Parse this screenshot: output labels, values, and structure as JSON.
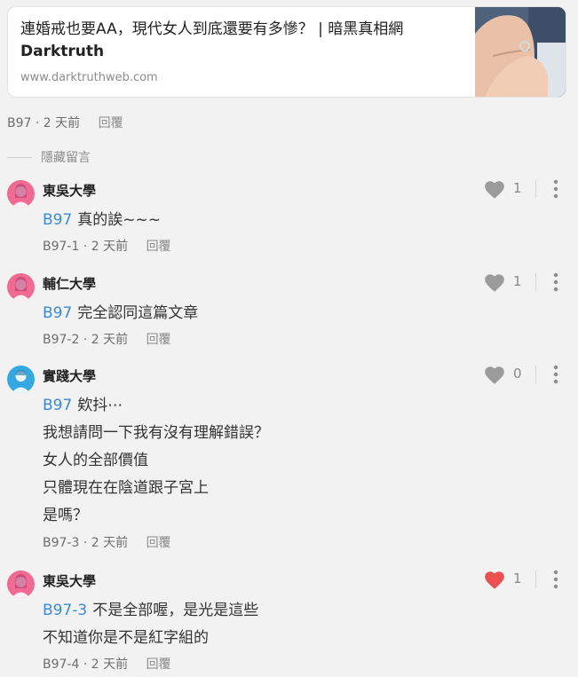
{
  "link_card": {
    "title": "連婚戒也要AA，現代女人到底還要有多慘？ | 暗黑真相網",
    "brand": "Darktruth",
    "url": "www.darktruthweb.com"
  },
  "parent_meta": {
    "floor": "B97",
    "time": "2 天前",
    "reply": "回覆"
  },
  "hidden_label": "隱藏留言",
  "comments": [
    {
      "school": "東吳大學",
      "avatar_color": "#f06a93",
      "tag": "B97",
      "lines": [
        "真的誒~~~"
      ],
      "floor": "B97-1",
      "time": "2 天前",
      "reply": "回覆",
      "likes": "1",
      "liked": false,
      "like_icon": "heart-icon"
    },
    {
      "school": "輔仁大學",
      "avatar_color": "#f06a93",
      "tag": "B97",
      "lines": [
        "完全認同這篇文章"
      ],
      "floor": "B97-2",
      "time": "2 天前",
      "reply": "回覆",
      "likes": "1",
      "liked": false,
      "like_icon": "heart-icon"
    },
    {
      "school": "實踐大學",
      "avatar_color": "#36a8e0",
      "tag": "B97",
      "lines": [
        "欸抖⋯",
        "我想請問一下我有沒有理解錯誤？",
        "女人的全部價值",
        "只體現在在陰道跟子宮上",
        "是嗎？"
      ],
      "floor": "B97-3",
      "time": "2 天前",
      "reply": "回覆",
      "likes": "0",
      "liked": false,
      "like_icon": "heart-icon"
    },
    {
      "school": "東吳大學",
      "avatar_color": "#f06a93",
      "tag": "B97-3",
      "lines": [
        "不是全部喔，是光是這些",
        "不知道你是不是紅字組的"
      ],
      "floor": "B97-4",
      "time": "2 天前",
      "reply": "回覆",
      "likes": "1",
      "liked": true,
      "like_icon": "heart-icon"
    }
  ],
  "colors": {
    "background": "#f2f2f2",
    "tag_blue": "#3b8ad6",
    "heart_gray": "#9b9b9b",
    "heart_red": "#e9504f"
  }
}
